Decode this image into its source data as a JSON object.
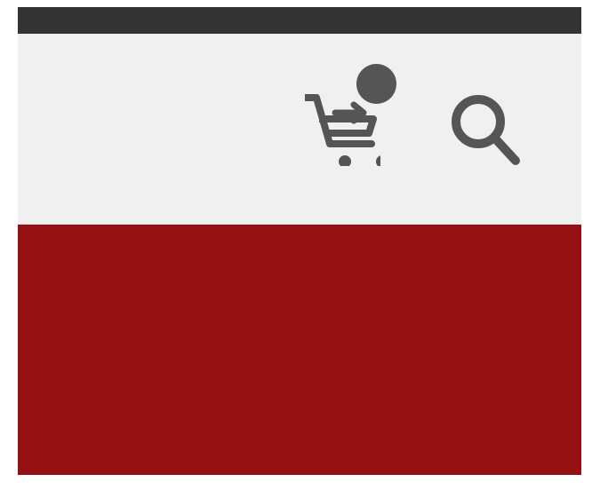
{
  "header": {
    "cart": {
      "icon": "add-to-cart-icon",
      "badge_icon": "cart-count-badge"
    },
    "search": {
      "icon": "search-icon"
    }
  },
  "colors": {
    "top_strip": "#333333",
    "header_background": "#f0f0f0",
    "icon_color": "#555555",
    "hero_background": "#951013"
  }
}
